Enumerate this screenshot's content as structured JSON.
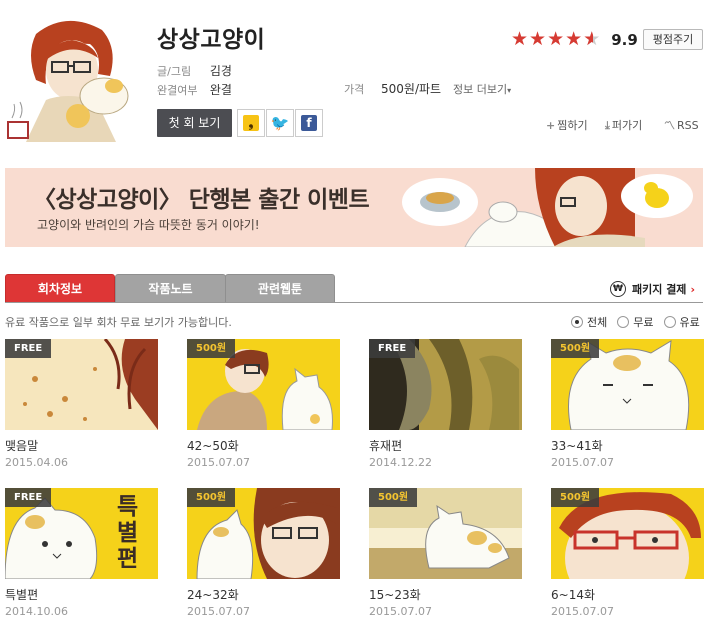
{
  "header": {
    "title": "상상고양이",
    "score": "9.9",
    "rate_button": "평점주기",
    "author_label": "글/그림",
    "author": "김경",
    "status_label": "완결여부",
    "status": "완결",
    "price_label": "가격",
    "price": "500원/파트",
    "info_more": "정보 더보기",
    "first_view": "첫 회 보기",
    "util": {
      "bookmark": "찜하기",
      "download": "퍼가기",
      "rss": "RSS"
    }
  },
  "banner": {
    "title": "〈상상고양이〉 단행본 출간 이벤트",
    "subtitle": "고양이와 반려인의 가슴 따뜻한 동거 이야기!"
  },
  "tabs": [
    "회차정보",
    "작품노트",
    "관련웹툰"
  ],
  "package": "패키지 결제",
  "notice": "유료 작품으로 일부 회차 무료 보기가 가능합니다.",
  "filters": [
    "전체",
    "무료",
    "유료"
  ],
  "episodes": [
    {
      "badge": "FREE",
      "title": "맺음말",
      "date": "2015.04.06"
    },
    {
      "badge": "500원",
      "title": "42~50화",
      "date": "2015.07.07"
    },
    {
      "badge": "FREE",
      "title": "휴재편",
      "date": "2014.12.22"
    },
    {
      "badge": "500원",
      "title": "33~41화",
      "date": "2015.07.07"
    },
    {
      "badge": "FREE",
      "title": "특별편",
      "date": "2014.10.06"
    },
    {
      "badge": "500원",
      "title": "24~32화",
      "date": "2015.07.07"
    },
    {
      "badge": "500원",
      "title": "15~23화",
      "date": "2015.07.07"
    },
    {
      "badge": "500원",
      "title": "6~14화",
      "date": "2015.07.07"
    }
  ],
  "special_text": "특별편",
  "colors": {
    "accent_red": "#de3636",
    "star_red": "#d63b33",
    "banner_bg": "#f9dcd0",
    "thumb_yellow": "#f5d21a"
  }
}
